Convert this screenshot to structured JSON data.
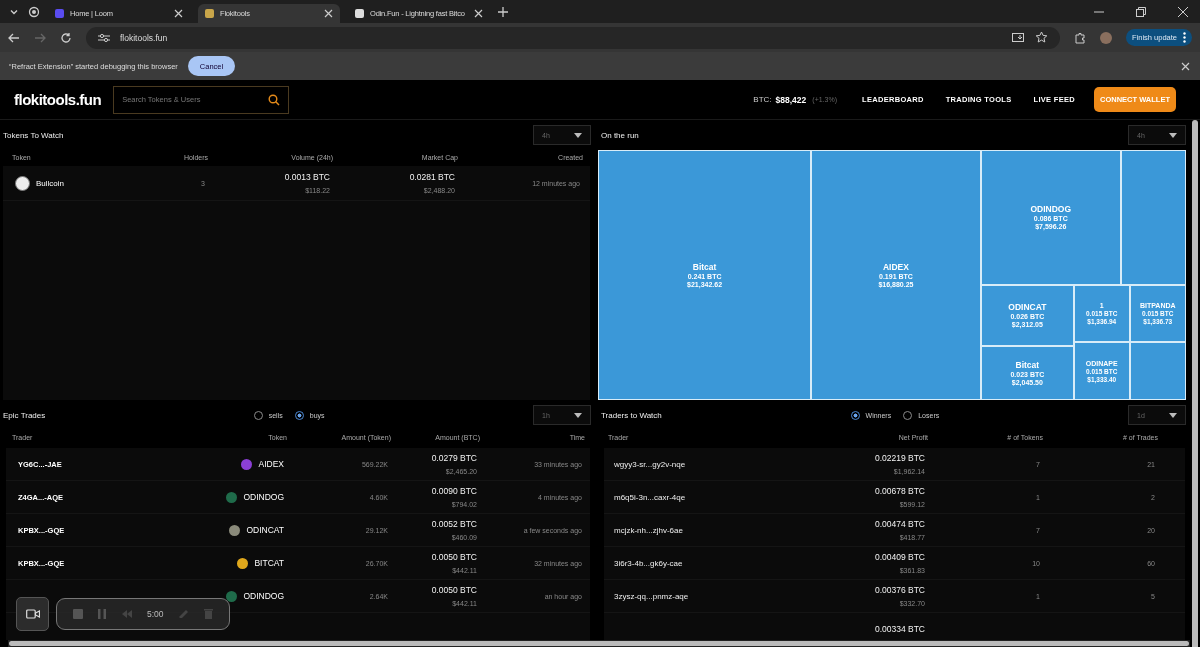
{
  "browser": {
    "tabs": [
      {
        "title": "Home | Loom",
        "selected": false
      },
      {
        "title": "Flokitools",
        "selected": true
      },
      {
        "title": "Odin.Fun - Lightning fast Bitco",
        "selected": false
      }
    ],
    "address": "flokitools.fun",
    "update_button": "Finish update",
    "infobar": {
      "message": "“Refract Extension” started debugging this browser",
      "button": "Cancel"
    }
  },
  "header": {
    "logo": "flokitools.fun",
    "search": {
      "placeholder": "Search Tokens & Users"
    },
    "btc": {
      "label": "BTC:",
      "price": "$88,422",
      "change": "(+1.3%)"
    },
    "nav": [
      "LEADERBOARD",
      "TRADING TOOLS",
      "LIVE FEED"
    ],
    "connect_button": "CONNECT WALLET"
  },
  "tokens_to_watch": {
    "title": "Tokens To Watch",
    "period": "4h",
    "columns": [
      "Token",
      "Holders",
      "Volume (24h)",
      "Market Cap",
      "Created"
    ],
    "rows": [
      {
        "token": "Bullcoin",
        "holders": "3",
        "volume_btc": "0.0013 BTC",
        "volume_usd": "$118.22",
        "cap_btc": "0.0281 BTC",
        "cap_usd": "$2,488.20",
        "created": "12 minutes ago"
      }
    ]
  },
  "on_the_run": {
    "title": "On the run",
    "period": "4h",
    "tiles": [
      {
        "kind": "label",
        "name": "Bitcat",
        "btc": "0.241 BTC",
        "usd": "$21,342.62"
      },
      {
        "kind": "label",
        "name": "AIDEX",
        "btc": "0.191 BTC",
        "usd": "$16,880.25"
      },
      {
        "kind": "label",
        "name": "ODINDOG",
        "btc": "0.086 BTC",
        "usd": "$7,596.26"
      },
      {
        "kind": "blank"
      },
      {
        "kind": "label",
        "name": "ODINCAT",
        "btc": "0.026 BTC",
        "usd": "$2,312.05"
      },
      {
        "kind": "label",
        "name": "Bitcat",
        "btc": "0.023 BTC",
        "usd": "$2,045.50"
      },
      {
        "kind": "label",
        "name": "1",
        "btc": "0.015 BTC",
        "usd": "$1,336.94"
      },
      {
        "kind": "label",
        "name": "BITPANDA",
        "btc": "0.015 BTC",
        "usd": "$1,336.73"
      },
      {
        "kind": "label",
        "name": "ODINAPE",
        "btc": "0.015 BTC",
        "usd": "$1,333.40"
      },
      {
        "kind": "blank"
      }
    ]
  },
  "epic_trades": {
    "title": "Epic Trades",
    "period": "1h",
    "filters": [
      {
        "label": "sells",
        "selected": false
      },
      {
        "label": "buys",
        "selected": true
      }
    ],
    "columns": [
      "Trader",
      "Token",
      "Amount (Token)",
      "Amount (BTC)",
      "Time"
    ],
    "rows": [
      {
        "trader": "YG6C...-JAE",
        "token": "AIDEX",
        "color": "#8b3fd6",
        "amount": "569.22K",
        "btc": "0.0279 BTC",
        "usd": "$2,465.20",
        "time": "33 minutes ago"
      },
      {
        "trader": "Z4GA...-AQE",
        "token": "ODINDOG",
        "color": "#1f6b4a",
        "amount": "4.60K",
        "btc": "0.0090 BTC",
        "usd": "$794.02",
        "time": "4 minutes ago"
      },
      {
        "trader": "KPBX...-GQE",
        "token": "ODINCAT",
        "color": "#8a8a7a",
        "amount": "29.12K",
        "btc": "0.0052 BTC",
        "usd": "$460.09",
        "time": "a few seconds ago"
      },
      {
        "trader": "KPBX...-GQE",
        "token": "BITCAT",
        "color": "#e0a81c",
        "amount": "26.70K",
        "btc": "0.0050 BTC",
        "usd": "$442.11",
        "time": "32 minutes ago"
      },
      {
        "token": "ODINDOG",
        "color": "#1f6b4a",
        "amount": "2.64K",
        "btc": "0.0050 BTC",
        "usd": "$442.11",
        "time": "an hour ago"
      }
    ]
  },
  "traders_to_watch": {
    "title": "Traders to Watch",
    "period": "1d",
    "filters": [
      {
        "label": "Winners",
        "selected": true
      },
      {
        "label": "Losers",
        "selected": false
      }
    ],
    "columns": [
      "Trader",
      "Net Profit",
      "# of Tokens",
      "# of Trades"
    ],
    "rows": [
      {
        "trader": "wgyy3-sr...gy2v-nqe",
        "btc": "0.02219 BTC",
        "usd": "$1,962.14",
        "tokens": "7",
        "trades": "21"
      },
      {
        "trader": "m6q5i-3n...caxr-4qe",
        "btc": "0.00678 BTC",
        "usd": "$599.12",
        "tokens": "1",
        "trades": "2"
      },
      {
        "trader": "mcjzk-nh...zjhv-6ae",
        "btc": "0.00474 BTC",
        "usd": "$418.77",
        "tokens": "7",
        "trades": "20"
      },
      {
        "trader": "3i6r3-4b...gk6y-cae",
        "btc": "0.00409 BTC",
        "usd": "$361.83",
        "tokens": "10",
        "trades": "60"
      },
      {
        "trader": "3zysz-qq...pnmz-aqe",
        "btc": "0.00376 BTC",
        "usd": "$332.70",
        "tokens": "1",
        "trades": "5"
      },
      {
        "btc": "0.00334 BTC"
      }
    ]
  },
  "recorder": {
    "time": "5:00"
  }
}
